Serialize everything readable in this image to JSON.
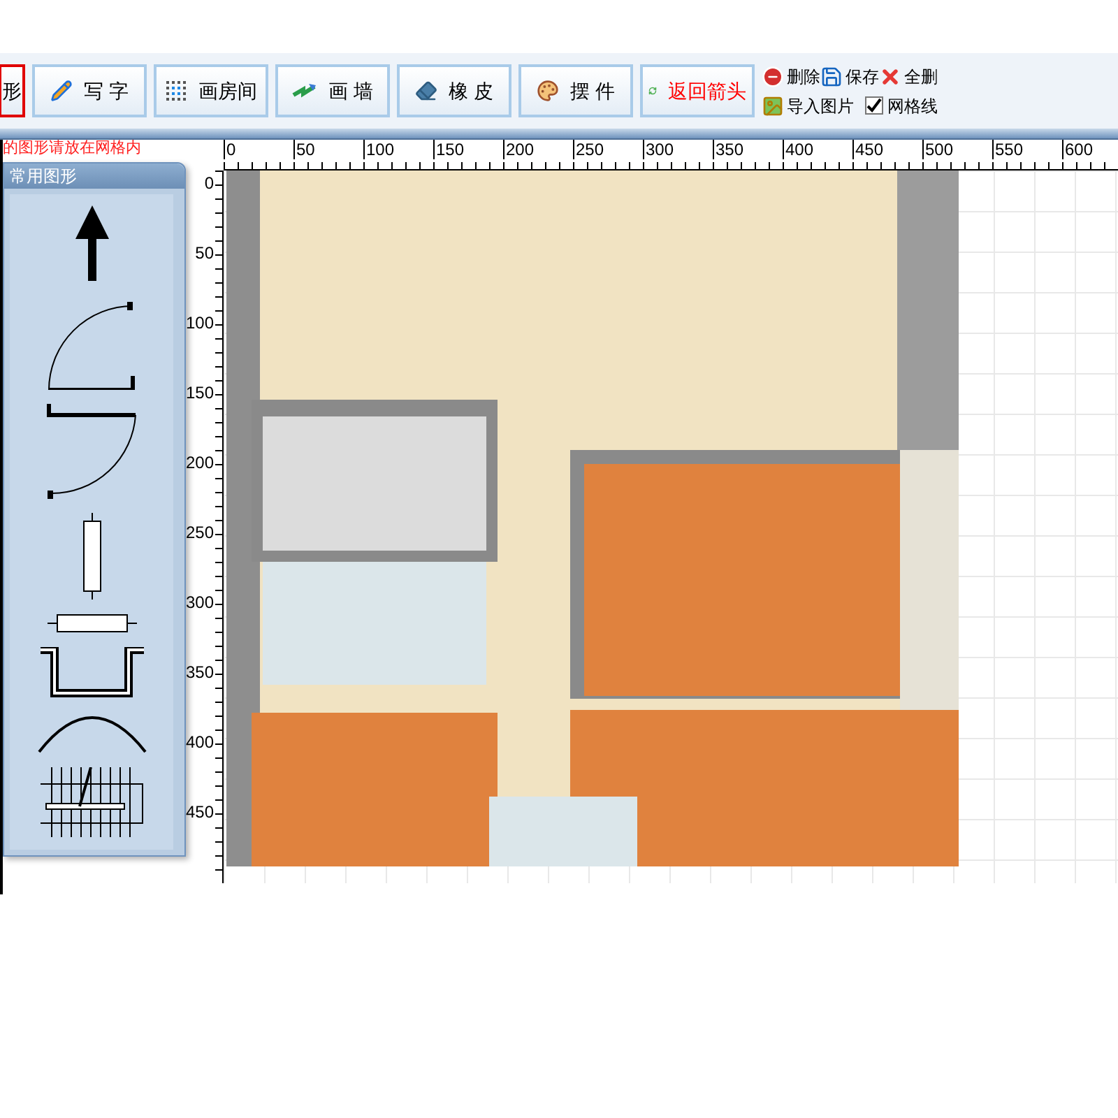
{
  "toolbar": {
    "tools": [
      {
        "label": "形",
        "selected": true,
        "color": "#000000"
      },
      {
        "label": "写 字",
        "selected": false,
        "color": "#000000"
      },
      {
        "label": "画房间",
        "selected": false,
        "color": "#000000"
      },
      {
        "label": "画 墙",
        "selected": false,
        "color": "#000000"
      },
      {
        "label": "橡 皮",
        "selected": false,
        "color": "#000000"
      },
      {
        "label": "摆 件",
        "selected": false,
        "color": "#000000"
      },
      {
        "label": "返回箭头",
        "selected": false,
        "color": "#ff0000"
      }
    ],
    "actions": [
      {
        "label": "删除"
      },
      {
        "label": "保存"
      },
      {
        "label": "全删"
      }
    ],
    "import": {
      "label": "导入图片"
    },
    "grid_toggle": {
      "label": "网格线",
      "checked": true
    }
  },
  "hint": "的图形请放在网格内",
  "shape_panel": {
    "title": "常用图形"
  },
  "ruler": {
    "x_labels": [
      "0",
      "50",
      "100",
      "150",
      "200",
      "250",
      "300",
      "350",
      "400",
      "450",
      "500",
      "550",
      "600"
    ],
    "y_labels": [
      "0",
      "50",
      "100",
      "150",
      "200",
      "250",
      "300",
      "350",
      "400",
      "450"
    ]
  }
}
